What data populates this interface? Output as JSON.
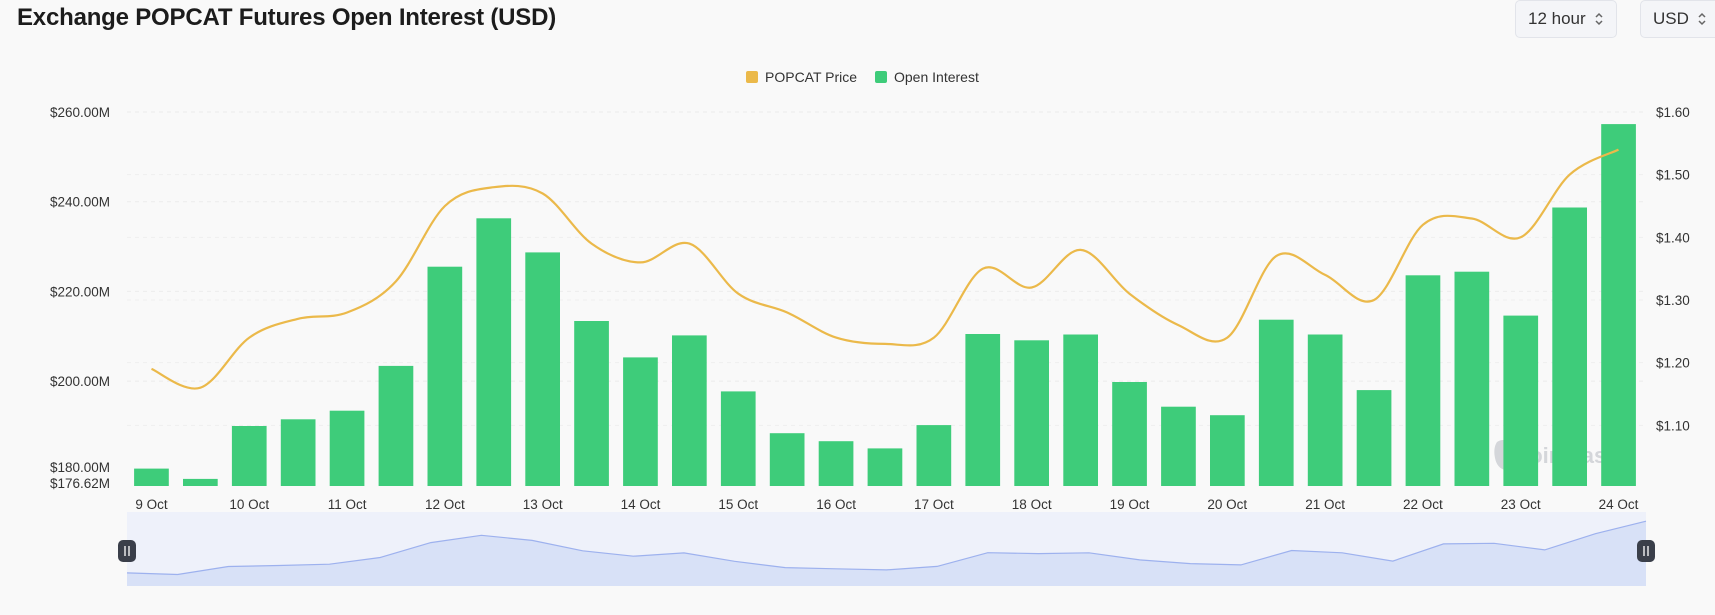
{
  "header": {
    "title": "Exchange POPCAT Futures Open Interest (USD)",
    "interval": "12 hour",
    "currency": "USD"
  },
  "watermark": "coinglass",
  "colors": {
    "bar": "#3ecc7a",
    "line": "#ebb94a",
    "navigator_fill": "#d8e1f7",
    "navigator_line": "#9db1ee"
  },
  "chart_data": {
    "type": "bar",
    "legend": [
      "POPCAT Price",
      "Open Interest"
    ],
    "legend_position": "top-center",
    "grid": true,
    "categories": [
      "9 Oct",
      "",
      "10 Oct",
      "",
      "11 Oct",
      "",
      "12 Oct",
      "",
      "13 Oct",
      "",
      "14 Oct",
      "",
      "15 Oct",
      "",
      "16 Oct",
      "",
      "17 Oct",
      "",
      "18 Oct",
      "",
      "19 Oct",
      "",
      "20 Oct",
      "",
      "21 Oct",
      "",
      "22 Oct",
      "",
      "23 Oct",
      "",
      "24 Oct"
    ],
    "x_tick_labels": [
      "9 Oct",
      "10 Oct",
      "11 Oct",
      "12 Oct",
      "13 Oct",
      "14 Oct",
      "15 Oct",
      "16 Oct",
      "17 Oct",
      "18 Oct",
      "19 Oct",
      "20 Oct",
      "21 Oct",
      "22 Oct",
      "23 Oct",
      "24 Oct"
    ],
    "series": [
      {
        "name": "Open Interest",
        "axis": "left",
        "values": [
          180.5,
          178.2,
          190.0,
          191.5,
          193.4,
          203.4,
          225.5,
          236.3,
          228.7,
          213.4,
          205.3,
          210.2,
          197.7,
          188.4,
          186.6,
          185.0,
          190.2,
          210.5,
          209.1,
          210.4,
          199.8,
          194.3,
          192.4,
          213.7,
          210.4,
          198.0,
          223.6,
          224.4,
          214.6,
          238.7,
          257.3
        ]
      },
      {
        "name": "POPCAT Price",
        "axis": "right",
        "type": "line",
        "values": [
          1.19,
          1.16,
          1.24,
          1.27,
          1.28,
          1.33,
          1.45,
          1.48,
          1.47,
          1.39,
          1.36,
          1.39,
          1.31,
          1.28,
          1.24,
          1.23,
          1.24,
          1.35,
          1.32,
          1.38,
          1.31,
          1.26,
          1.24,
          1.37,
          1.34,
          1.3,
          1.42,
          1.43,
          1.4,
          1.5,
          1.54
        ]
      }
    ],
    "y_left": {
      "ticks": [
        "$260.00M",
        "$240.00M",
        "$220.00M",
        "$200.00M",
        "$180.00M",
        "$176.62M"
      ],
      "range": [
        176.62,
        260
      ]
    },
    "y_right": {
      "ticks": [
        "$1.60",
        "$1.50",
        "$1.40",
        "$1.30",
        "$1.20",
        "$1.10"
      ],
      "range": [
        1.0,
        1.6
      ]
    }
  }
}
